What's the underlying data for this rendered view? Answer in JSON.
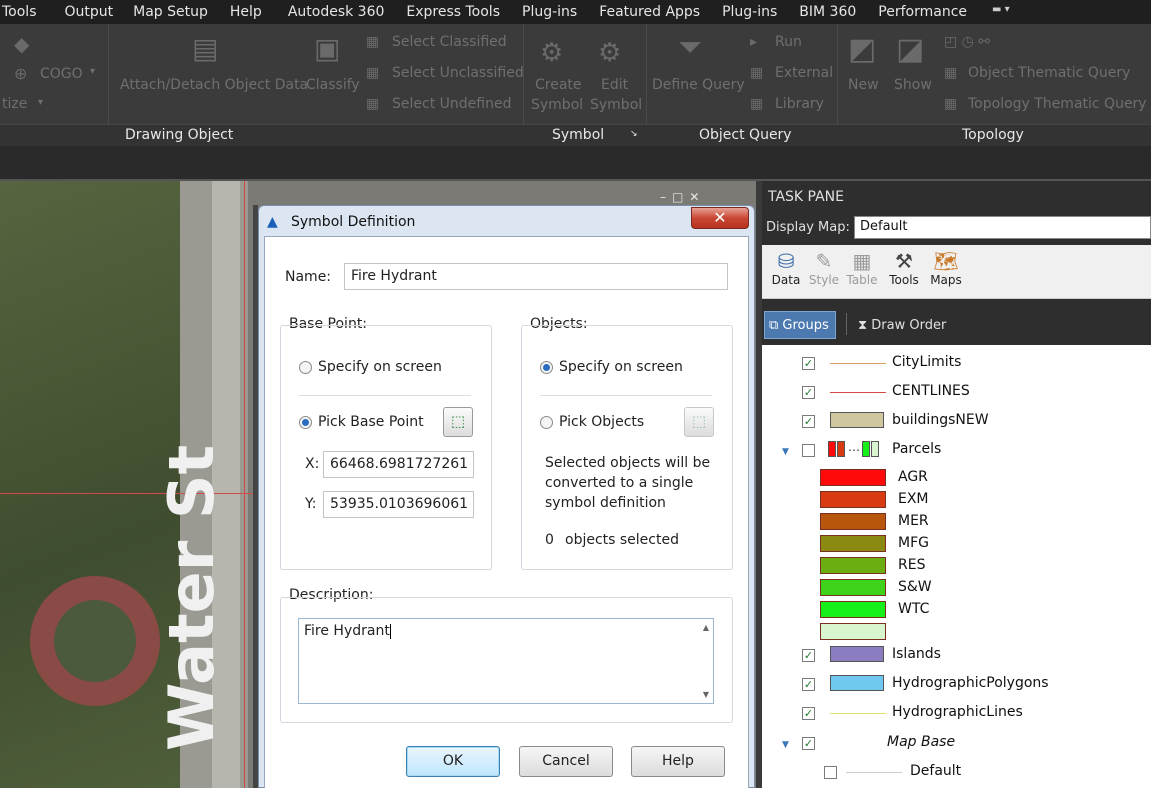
{
  "menubar": {
    "items": [
      "Tools",
      "Output",
      "Map Setup",
      "Help",
      "Autodesk 360",
      "Express Tools",
      "Plug-ins",
      "Featured Apps",
      "Plug-ins",
      "BIM 360",
      "Performance"
    ]
  },
  "ribbon": {
    "cogo_label": "COGO",
    "tize_label": "tize",
    "attach_label": "Attach/Detach Object Data",
    "classify_label": "Classify",
    "select_classified": "Select Classified",
    "select_unclassified": "Select Unclassified",
    "select_undefined": "Select Undefined",
    "create_symbol_1": "Create",
    "create_symbol_2": "Symbol",
    "edit_symbol_1": "Edit",
    "edit_symbol_2": "Symbol",
    "define_query": "Define Query",
    "run": "Run",
    "external": "External",
    "library": "Library",
    "new": "New",
    "show": "Show",
    "object_thematic": "Object Thematic Query",
    "topology_thematic": "Topology Thematic Query",
    "panels": {
      "drawing_object": "Drawing Object",
      "symbol": "Symbol",
      "object_query": "Object Query",
      "topology": "Topology"
    }
  },
  "map": {
    "street_label": "Water St"
  },
  "dialog": {
    "title": "Symbol Definition",
    "close": "✕",
    "name_label": "Name:",
    "name_value": "Fire Hydrant",
    "base_point": {
      "title": "Base Point:",
      "specify_on_screen": "Specify on screen",
      "pick_base_point": "Pick Base Point",
      "x_label": "X:",
      "x_value": "66468.6981727261",
      "y_label": "Y:",
      "y_value": "53935.0103696061"
    },
    "objects": {
      "title": "Objects:",
      "specify_on_screen": "Specify on screen",
      "pick_objects": "Pick Objects",
      "info_line1": "Selected objects will be",
      "info_line2": "converted to a single",
      "info_line3": "symbol definition",
      "count": "0",
      "count_suffix": "objects selected"
    },
    "description_label": "Description:",
    "description_value": "Fire Hydrant",
    "ok": "OK",
    "cancel": "Cancel",
    "help": "Help"
  },
  "taskpane": {
    "title": "TASK PANE",
    "display_map_label": "Display Map:",
    "display_map_value": "Default",
    "tools": [
      {
        "label": "Data",
        "icon": "database-icon"
      },
      {
        "label": "Style",
        "icon": "brush-icon"
      },
      {
        "label": "Table",
        "icon": "table-icon"
      },
      {
        "label": "Tools",
        "icon": "tools-icon"
      },
      {
        "label": "Maps",
        "icon": "map-icon"
      }
    ],
    "tab_groups": "Groups",
    "tab_draw_order": "Draw Order",
    "layers": [
      {
        "name": "CityLimits"
      },
      {
        "name": "CENTLINES"
      },
      {
        "name": "buildingsNEW"
      },
      {
        "name": "Parcels"
      },
      {
        "name": "Islands"
      },
      {
        "name": "HydrographicPolygons"
      },
      {
        "name": "HydrographicLines"
      },
      {
        "name": "Map Base"
      },
      {
        "name": "Default"
      }
    ],
    "parcel_classes": [
      {
        "label": "AGR",
        "color": "#ff0a0a"
      },
      {
        "label": "EXM",
        "color": "#d83a12"
      },
      {
        "label": "MER",
        "color": "#b8560e"
      },
      {
        "label": "MFG",
        "color": "#8a8a12"
      },
      {
        "label": "RES",
        "color": "#6aae12"
      },
      {
        "label": "S&W",
        "color": "#3ed21a"
      },
      {
        "label": "WTC",
        "color": "#16f01a"
      },
      {
        "label": "",
        "color": "#d8f5d0"
      }
    ],
    "colors": {
      "citylimits": "#d6a26a",
      "centlines": "#d04a4a",
      "buildings": "#cfc7a0",
      "islands": "#8c7cc0",
      "hydro_poly": "#6ec8f0",
      "hydro_lines": "#e6e06a"
    }
  }
}
